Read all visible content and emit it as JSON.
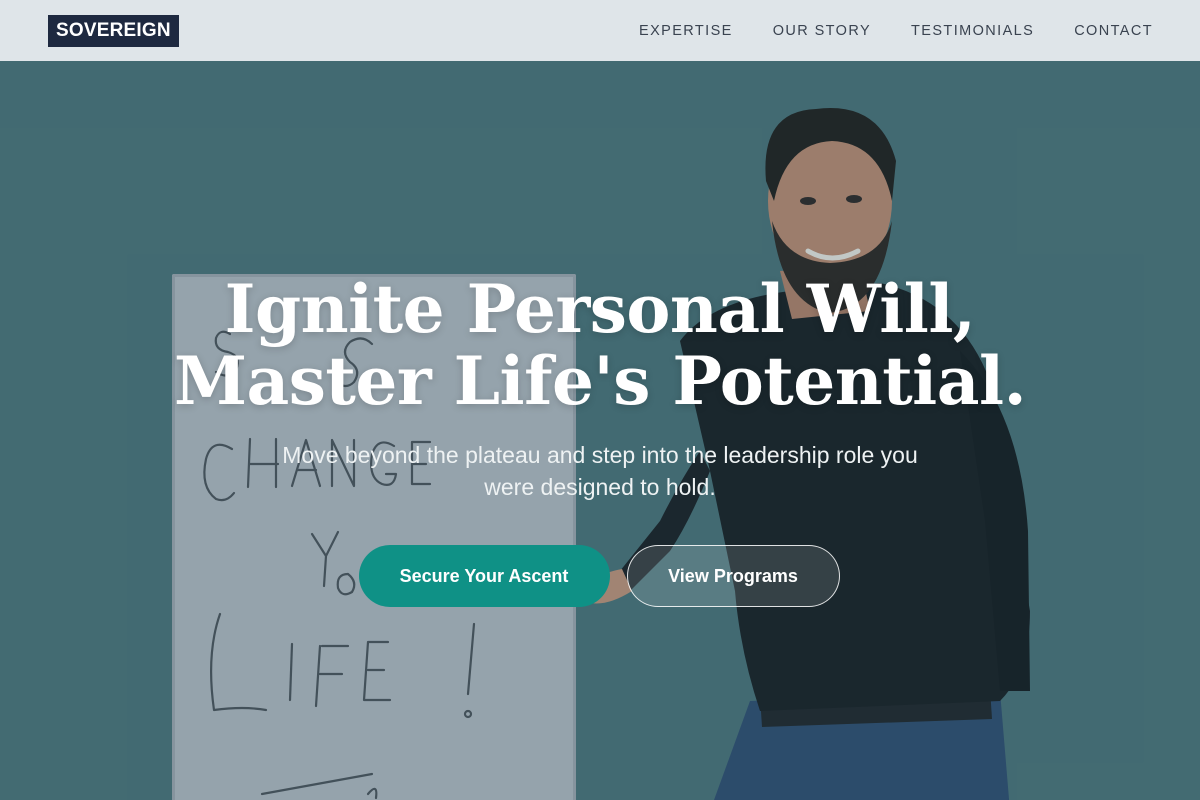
{
  "header": {
    "logo": "SOVEREIGN",
    "nav": [
      {
        "label": "EXPERTISE"
      },
      {
        "label": "OUR STORY"
      },
      {
        "label": "TESTIMONIALS"
      },
      {
        "label": "CONTACT"
      }
    ]
  },
  "hero": {
    "headline_line1": "Ignite Personal Will,",
    "headline_line2": "Master Life's Potential.",
    "subtitle": "Move beyond the plateau and step into the leadership role you were designed to hold.",
    "primary_button": "Secure Your Ascent",
    "secondary_button": "View Programs"
  },
  "colors": {
    "accent": "#0f9186",
    "brand_dark": "#1e2940",
    "header_bg": "#dfe5e9",
    "hero_bg": "#4a7279"
  }
}
